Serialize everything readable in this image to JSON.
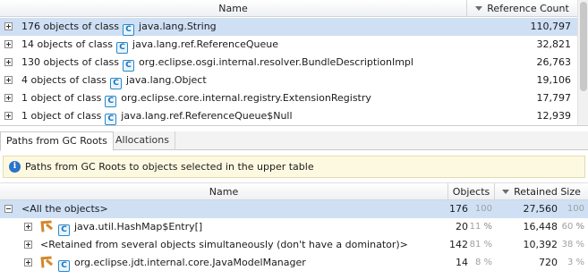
{
  "upper_table": {
    "columns": {
      "name": "Name",
      "ref_count": "Reference Count"
    },
    "rows": [
      {
        "text": "176 objects of class",
        "cls": "java.lang.String",
        "count": "110,797"
      },
      {
        "text": "14 objects of class",
        "cls": "java.lang.ref.ReferenceQueue",
        "count": "32,821"
      },
      {
        "text": "130 objects of class",
        "cls": "org.eclipse.osgi.internal.resolver.BundleDescriptionImpl",
        "count": "26,763"
      },
      {
        "text": "4 objects of class",
        "cls": "java.lang.Object",
        "count": "19,106"
      },
      {
        "text": "1 object of class",
        "cls": "org.eclipse.core.internal.registry.ExtensionRegistry",
        "count": "17,797"
      },
      {
        "text": "1 object of class",
        "cls": "java.lang.ref.ReferenceQueue$Null",
        "count": "12,939"
      }
    ]
  },
  "tabs": [
    {
      "label": "Paths from GC Roots"
    },
    {
      "label": "Allocations"
    }
  ],
  "info_bar": {
    "icon": "i",
    "text": "Paths from GC Roots to objects selected in the upper table"
  },
  "lower_table": {
    "columns": {
      "name": "Name",
      "objects": "Objects",
      "retained": "Retained Size"
    },
    "rows": [
      {
        "name": "<All the objects>",
        "objects": "176",
        "objects_pct": "100 %",
        "retained": "27,560",
        "retained_pct": "100 %"
      },
      {
        "name": "java.util.HashMap$Entry[]",
        "objects": "20",
        "objects_pct": "11 %",
        "retained": "16,448",
        "retained_pct": "60 %"
      },
      {
        "name": "<Retained from several objects simultaneously (don't have a dominator)>",
        "objects": "142",
        "objects_pct": "81 %",
        "retained": "10,392",
        "retained_pct": "38 %"
      },
      {
        "name": "org.eclipse.jdt.internal.core.JavaModelManager",
        "objects": "14",
        "objects_pct": "8 %",
        "retained": "720",
        "retained_pct": "3 %"
      }
    ]
  },
  "icons": {
    "class_icon_letter": "C"
  },
  "colors": {
    "selection": "#cfe0f5",
    "class_icon": "#2a88c8",
    "ref_icon": "#d4882a",
    "info_bg": "#fdf9e1"
  }
}
